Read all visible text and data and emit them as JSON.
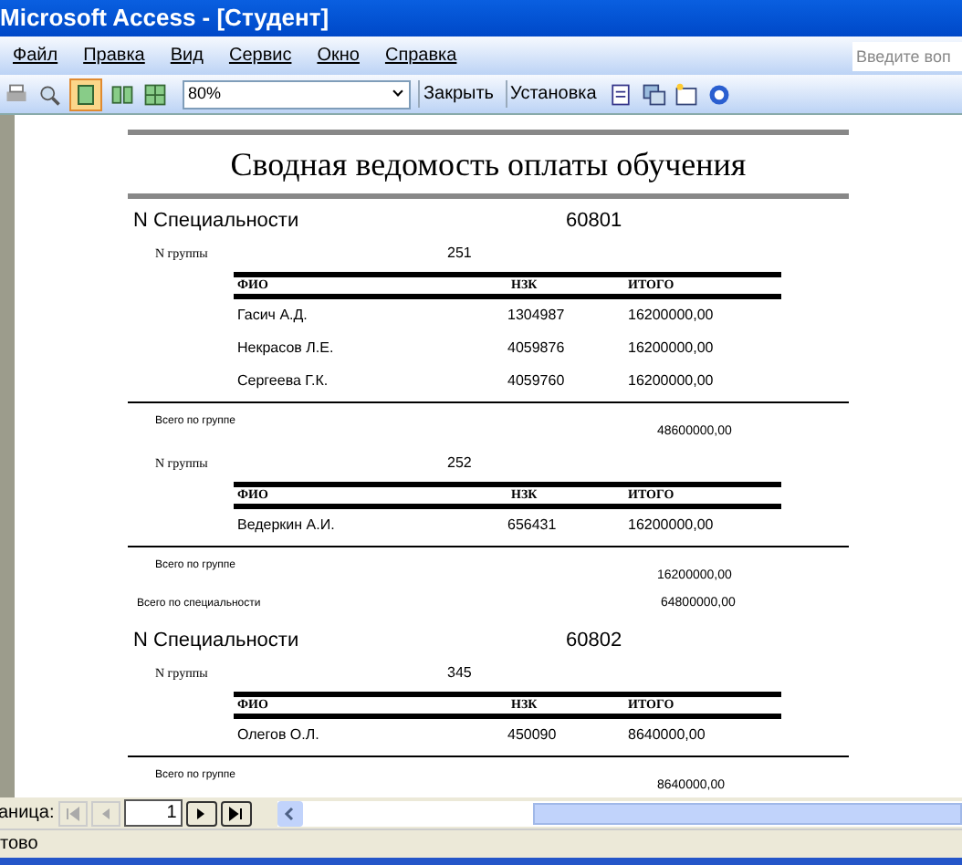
{
  "window": {
    "title": "Microsoft Access - [Студент]"
  },
  "menu": [
    "Файл",
    "Правка",
    "Вид",
    "Сервис",
    "Окно",
    "Справка"
  ],
  "help_search": {
    "placeholder": "Введите воп"
  },
  "toolbar": {
    "zoom": "80%",
    "buttons": [
      "Закрыть",
      "Установка"
    ],
    "one_page_selected": true
  },
  "report": {
    "title": "Сводная ведомость оплаты обучения",
    "specialties": [
      {
        "label": "N Специальности",
        "value": "60801",
        "groups": [
          {
            "label": "N группы",
            "value": "251",
            "columns": [
              "ФИО",
              "НЗК",
              "ИТОГО"
            ],
            "rows": [
              {
                "name": "Гасич А.Д.",
                "code": "1304987",
                "total": "16200000,00"
              },
              {
                "name": "Некрасов Л.Е.",
                "code": "4059876",
                "total": "16200000,00"
              },
              {
                "name": "Сергеева Г.К.",
                "code": "4059760",
                "total": "16200000,00"
              }
            ],
            "total_label": "Всего по группе",
            "total": "48600000,00"
          },
          {
            "label": "N группы",
            "value": "252",
            "columns": [
              "ФИО",
              "НЗК",
              "ИТОГО"
            ],
            "rows": [
              {
                "name": "Ведеркин А.И.",
                "code": "656431",
                "total": "16200000,00"
              }
            ],
            "total_label": "Всего по группе",
            "total": "16200000,00"
          }
        ],
        "total_label": "Всего по специальности",
        "total": "64800000,00"
      },
      {
        "label": "N Специальности",
        "value": "60802",
        "groups": [
          {
            "label": "N группы",
            "value": "345",
            "columns": [
              "ФИО",
              "НЗК",
              "ИТОГО"
            ],
            "rows": [
              {
                "name": "Олегов О.Л.",
                "code": "450090",
                "total": "8640000,00"
              }
            ],
            "total_label": "Всего по группе",
            "total": "8640000,00"
          }
        ]
      }
    ]
  },
  "navigation": {
    "label": "аница:",
    "page": "1"
  },
  "status_bar": "тово"
}
